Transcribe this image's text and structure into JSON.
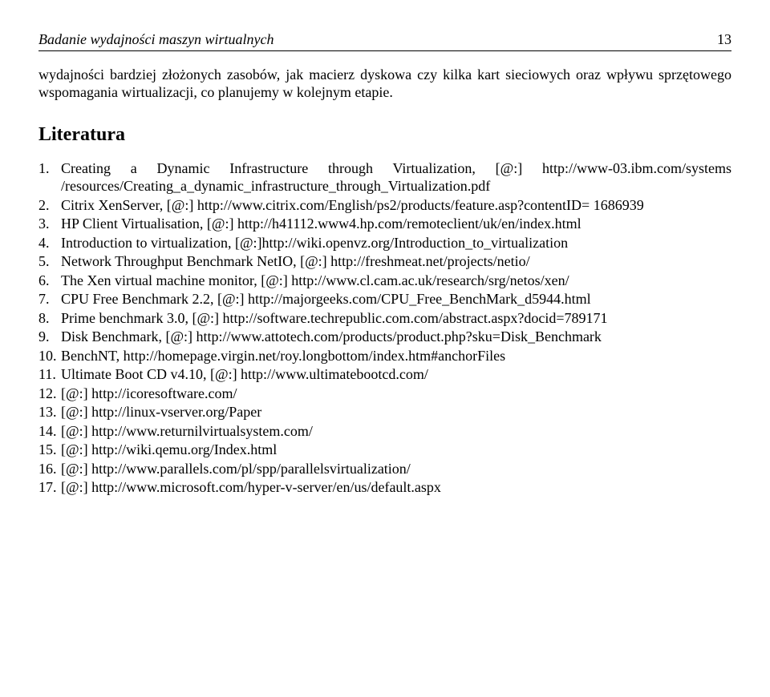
{
  "header": {
    "title": "Badanie wydajności maszyn wirtualnych",
    "page": "13"
  },
  "paragraph": "wydajności bardziej złożonych zasobów, jak macierz dyskowa czy kilka kart sieciowych oraz wpływu sprzętowego wspomagania wirtualizacji, co planujemy w kolejnym etapie.",
  "section_heading": "Literatura",
  "references": [
    {
      "n": "1.",
      "text": "Creating a Dynamic Infrastructure through Virtualization, [@:] http://www-03.ibm.com/systems /resources/Creating_a_dynamic_infrastructure_through_Virtualization.pdf"
    },
    {
      "n": "2.",
      "text": "Citrix XenServer, [@:] http://www.citrix.com/English/ps2/products/feature.asp?contentID= 1686939"
    },
    {
      "n": "3.",
      "text": "HP Client Virtualisation, [@:] http://h41112.www4.hp.com/remoteclient/uk/en/index.html"
    },
    {
      "n": "4.",
      "text": "Introduction to virtualization, [@:]http://wiki.openvz.org/Introduction_to_virtualization"
    },
    {
      "n": "5.",
      "text": "Network Throughput Benchmark NetIO, [@:] http://freshmeat.net/projects/netio/"
    },
    {
      "n": "6.",
      "text": "The Xen virtual machine monitor, [@:] http://www.cl.cam.ac.uk/research/srg/netos/xen/"
    },
    {
      "n": "7.",
      "text": "CPU Free Benchmark 2.2, [@:] http://majorgeeks.com/CPU_Free_BenchMark_d5944.html"
    },
    {
      "n": "8.",
      "text": "Prime benchmark 3.0, [@:] http://software.techrepublic.com.com/abstract.aspx?docid=789171"
    },
    {
      "n": "9.",
      "text": "Disk Benchmark, [@:] http://www.attotech.com/products/product.php?sku=Disk_Benchmark"
    },
    {
      "n": "10.",
      "text": "BenchNT, http://homepage.virgin.net/roy.longbottom/index.htm#anchorFiles"
    },
    {
      "n": "11.",
      "text": "Ultimate Boot CD v4.10, [@:] http://www.ultimatebootcd.com/"
    },
    {
      "n": "12.",
      "text": "[@:] http://icoresoftware.com/"
    },
    {
      "n": "13.",
      "text": "[@:] http://linux-vserver.org/Paper"
    },
    {
      "n": "14.",
      "text": "[@:] http://www.returnilvirtualsystem.com/"
    },
    {
      "n": "15.",
      "text": "[@:] http://wiki.qemu.org/Index.html"
    },
    {
      "n": "16.",
      "text": "[@:] http://www.parallels.com/pl/spp/parallelsvirtualization/"
    },
    {
      "n": "17.",
      "text": "[@:] http://www.microsoft.com/hyper-v-server/en/us/default.aspx"
    }
  ]
}
